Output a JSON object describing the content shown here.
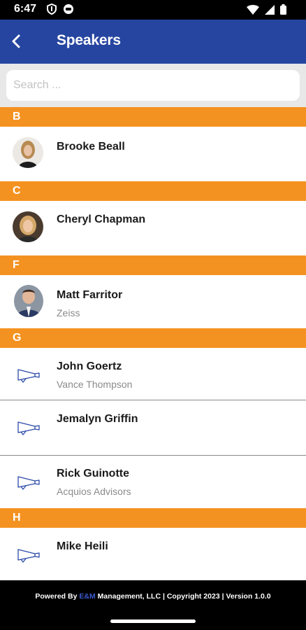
{
  "status_bar": {
    "time": "6:47"
  },
  "app_bar": {
    "title": "Speakers"
  },
  "search": {
    "placeholder": "Search ..."
  },
  "sections": [
    {
      "letter": "B",
      "speakers": [
        {
          "name": "Brooke Beall",
          "company": ""
        }
      ]
    },
    {
      "letter": "C",
      "speakers": [
        {
          "name": "Cheryl Chapman",
          "company": ""
        }
      ]
    },
    {
      "letter": "F",
      "speakers": [
        {
          "name": "Matt Farritor",
          "company": "Zeiss"
        }
      ]
    },
    {
      "letter": "G",
      "speakers": [
        {
          "name": "John Goertz",
          "company": "Vance Thompson"
        },
        {
          "name": "Jemalyn Griffin",
          "company": ""
        },
        {
          "name": "Rick Guinotte",
          "company": "Acquios Advisors"
        }
      ]
    },
    {
      "letter": "H",
      "speakers": [
        {
          "name": "Mike Heili",
          "company": ""
        }
      ]
    }
  ],
  "footer": {
    "prefix": "Powered By ",
    "brand": "E&M",
    "suffix": " Management, LLC | Copyright 2023 | Version 1.0.0"
  },
  "colors": {
    "app_bar": "#2645a0",
    "section_header": "#f49221",
    "footer_brand": "#3c5ad1"
  },
  "icons": {
    "back": "chevron-left-icon",
    "placeholder_avatar": "megaphone-icon"
  }
}
